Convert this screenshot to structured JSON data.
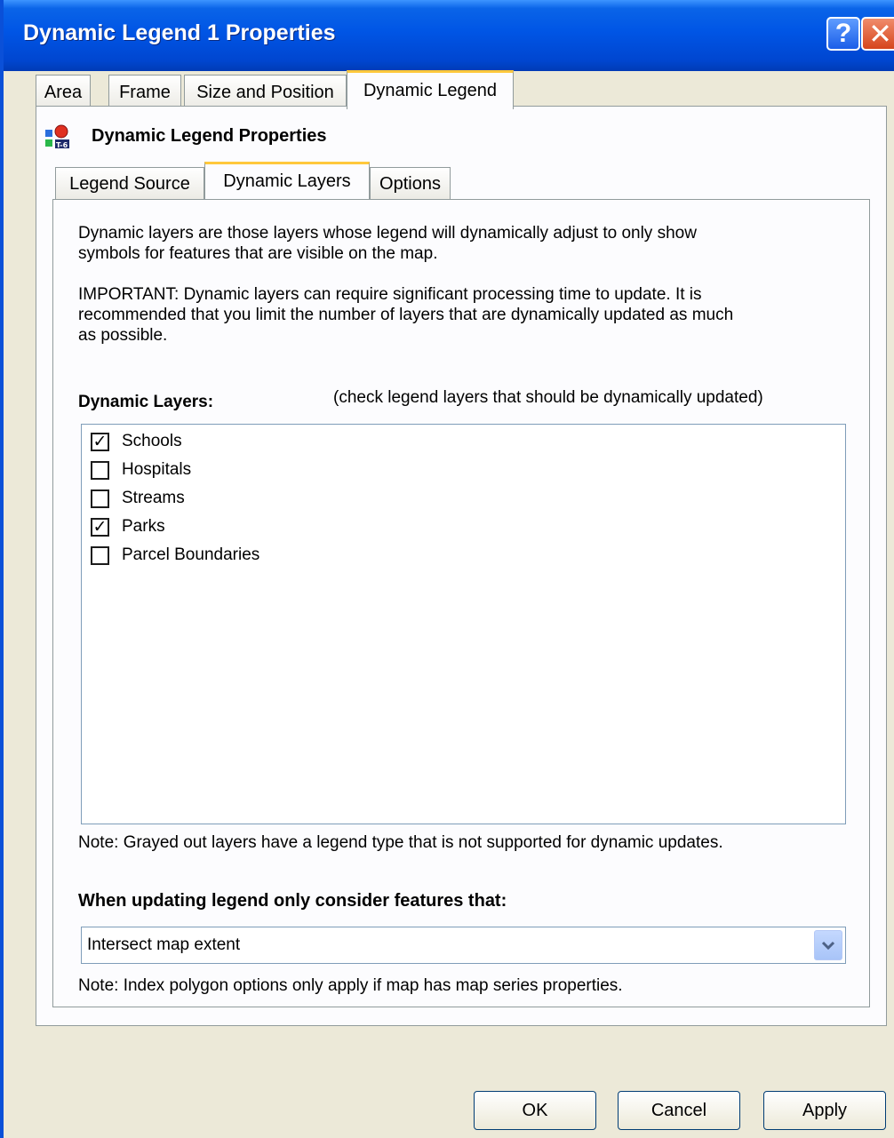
{
  "window": {
    "title": "Dynamic Legend 1 Properties",
    "help_label": "?",
    "close_label": "✕"
  },
  "outer_tabs": [
    {
      "label": "Area"
    },
    {
      "label": "Frame"
    },
    {
      "label": "Size and Position"
    },
    {
      "label": "Dynamic Legend",
      "active": true
    }
  ],
  "panel": {
    "title": "Dynamic Legend Properties",
    "icon": "legend-properties-icon"
  },
  "inner_tabs": [
    {
      "label": "Legend Source"
    },
    {
      "label": "Dynamic Layers",
      "active": true
    },
    {
      "label": "Options"
    }
  ],
  "description": {
    "line1": "Dynamic layers are those layers whose legend will dynamically adjust to only show",
    "line2": "symbols for features that are visible on the map.",
    "important1": "IMPORTANT:  Dynamic layers can require significant processing time to update.  It is",
    "important2": "recommended that you limit the number of layers that are dynamically updated as much",
    "important3": "as possible."
  },
  "layers_section": {
    "label": "Dynamic Layers:",
    "hint": "(check legend layers that should be dynamically updated)",
    "items": [
      {
        "label": "Schools",
        "checked": true
      },
      {
        "label": "Hospitals",
        "checked": false
      },
      {
        "label": "Streams",
        "checked": false
      },
      {
        "label": "Parks",
        "checked": true
      },
      {
        "label": "Parcel Boundaries",
        "checked": false
      }
    ],
    "note": "Note: Grayed out layers have a legend type that is not supported for dynamic updates."
  },
  "update_section": {
    "label": "When updating legend only consider features that:",
    "selected": "Intersect map extent",
    "note": "Note: Index polygon options only apply if map has map series properties."
  },
  "buttons": {
    "ok": "OK",
    "cancel": "Cancel",
    "apply": "Apply"
  },
  "colors": {
    "titlebar": "#0055e5",
    "tab_highlight": "#ffc83c",
    "dialog_bg": "#ece9d8"
  }
}
